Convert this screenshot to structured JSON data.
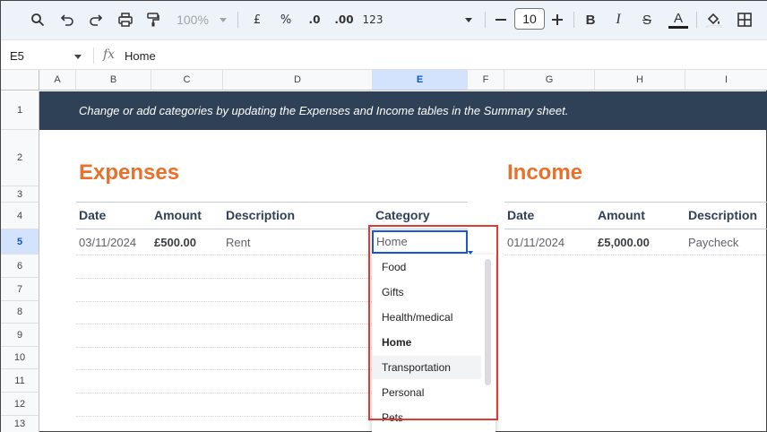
{
  "toolbar": {
    "zoom": "100%",
    "currency": "£",
    "percent": "%",
    "decrease_decimal": ".0",
    "increase_decimal": ".00",
    "number_format": "123",
    "font_size": "10",
    "minus": "—",
    "plus": "+",
    "bold": "B",
    "italic": "I",
    "strike": "S",
    "text_color": "A"
  },
  "formula_bar": {
    "cell_ref": "E5",
    "fx": "fx",
    "value": "Home"
  },
  "columns": [
    "A",
    "B",
    "C",
    "D",
    "E",
    "F",
    "G",
    "H",
    "I"
  ],
  "rows": [
    "1",
    "2",
    "3",
    "4",
    "5",
    "6",
    "7",
    "8",
    "9",
    "10",
    "11",
    "12",
    "13"
  ],
  "banner": "Change or add categories by updating the Expenses and Income tables in the Summary sheet.",
  "expenses": {
    "title": "Expenses",
    "headers": [
      "Date",
      "Amount",
      "Description",
      "Category"
    ],
    "row": {
      "date": "03/11/2024",
      "amount": "£500.00",
      "description": "Rent",
      "category": "Home"
    }
  },
  "income": {
    "title": "Income",
    "headers": [
      "Date",
      "Amount",
      "Description"
    ],
    "row": {
      "date": "01/11/2024",
      "amount": "£5,000.00",
      "description": "Paycheck"
    }
  },
  "dropdown": {
    "items": [
      "Food",
      "Gifts",
      "Health/medical",
      "Home",
      "Transportation",
      "Personal",
      "Pets"
    ],
    "selected": "Home",
    "hovered": "Transportation"
  },
  "colors": {
    "banner": "#2f4157",
    "section_title": "#e8702a",
    "selection": "#1a57d6",
    "highlight": "#e53935"
  }
}
